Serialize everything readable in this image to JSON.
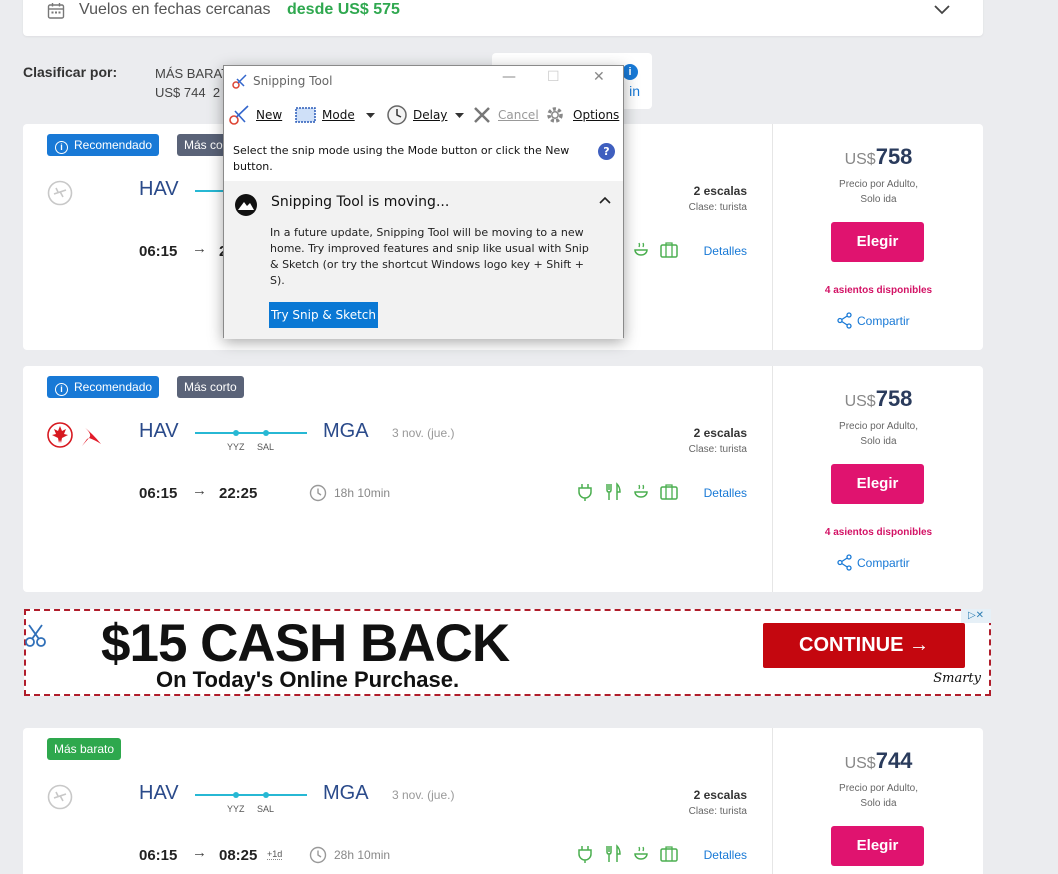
{
  "nearby": {
    "label": "Vuelos en fechas cercanas",
    "price": "desde US$ 575"
  },
  "sort": {
    "label": "Clasificar por:",
    "option_name": "MÁS BARATO",
    "option_price": "US$ 744",
    "option_extra": "2",
    "card_suffix": "in",
    "info_glyph": "i"
  },
  "badges": {
    "recommended": "Recomendado",
    "shortest": "Más corto",
    "cheapest": "Más barato",
    "info_glyph": "i"
  },
  "common": {
    "origin": "HAV",
    "destination": "MGA",
    "stop1": "YYZ",
    "stop2": "SAL",
    "date": "3 nov. (jue.)",
    "stops_label": "2 escalas",
    "class_label": "Clase: turista",
    "arrow": "→",
    "details": "Detalles",
    "currency": "US$",
    "price_note_1": "Precio por Adulto,",
    "price_note_2": "Solo ida",
    "select": "Elegir",
    "share": "Compartir"
  },
  "flights": [
    {
      "depart": "06:15",
      "arrive": "2",
      "duration": "",
      "price": "758",
      "seats": "4 asientos disponibles"
    },
    {
      "depart": "06:15",
      "arrive": "22:25",
      "duration": "18h 10min",
      "price": "758",
      "seats": "4 asientos disponibles"
    },
    {
      "depart": "06:15",
      "arrive": "08:25",
      "plus_day": "+1d",
      "duration": "28h 10min",
      "price": "744"
    }
  ],
  "ad": {
    "headline": "$15 CASH BACK",
    "subline": "On Today's Online Purchase.",
    "cta": "CONTINUE →",
    "brand": "Smarty",
    "adchoices": "▷✕"
  },
  "snipping_tool": {
    "title": "Snipping Tool",
    "new": "New",
    "mode": "Mode",
    "delay": "Delay",
    "cancel": "Cancel",
    "options": "Options",
    "minimize": "—",
    "maximize": "☐",
    "close": "✕",
    "instruction": "Select the snip mode using the Mode button or click the New button.",
    "help": "?",
    "notice_title": "Snipping Tool is moving...",
    "notice_body": "In a future update, Snipping Tool will be moving to a new home. Try improved features and snip like usual with Snip & Sketch (or try the shortcut Windows logo key + Shift + S).",
    "try_button": "Try Snip & Sketch"
  },
  "colors": {
    "accent_blue": "#1879d6",
    "select_pink": "#e0136f",
    "route_cyan": "#27b8d4",
    "green": "#2fa84f"
  }
}
